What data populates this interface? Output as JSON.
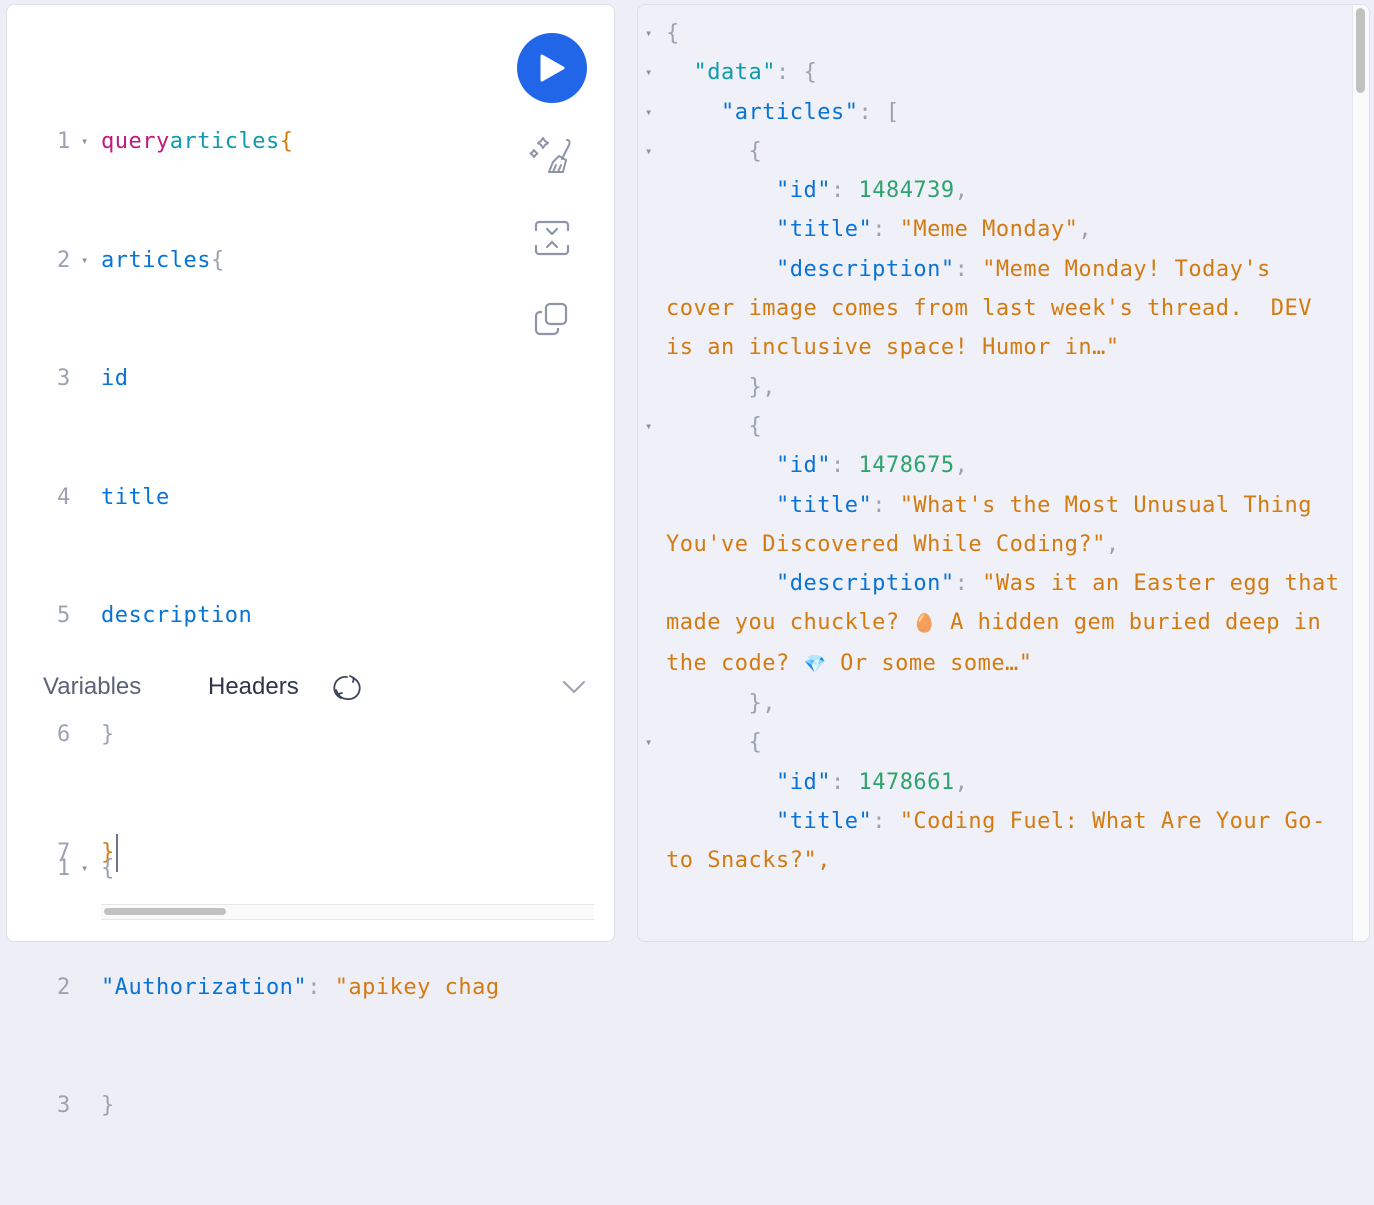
{
  "query_editor": {
    "lines": [
      {
        "num": "1",
        "fold": "▾",
        "keyword": "query",
        "name": "articles",
        "brace": "{"
      },
      {
        "num": "2",
        "fold": "▾",
        "field": "articles",
        "brace": "{"
      },
      {
        "num": "3",
        "field": "id"
      },
      {
        "num": "4",
        "field": "title"
      },
      {
        "num": "5",
        "field": "description"
      },
      {
        "num": "6",
        "brace": "}"
      },
      {
        "num": "7",
        "brace": "}"
      }
    ]
  },
  "toolbar": {
    "run_icon": "play-icon",
    "prettify_icon": "sparkle-broom-icon",
    "merge_icon": "merge-fragments-icon",
    "copy_icon": "copy-icon"
  },
  "bottom_tabs": {
    "variables_label": "Variables",
    "headers_label": "Headers",
    "refresh_icon": "refresh-icon",
    "collapse_icon": "chevron-down-icon"
  },
  "headers_editor": {
    "lines": [
      {
        "num": "1",
        "fold": "▾",
        "brace": "{"
      },
      {
        "num": "2",
        "key": "\"Authorization\"",
        "colon": ": ",
        "value": "\"apikey chag"
      },
      {
        "num": "3",
        "brace": "}"
      }
    ]
  },
  "result": {
    "root_open": "{",
    "data_key": "\"data\"",
    "articles_key": "\"articles\"",
    "articles": [
      {
        "id": "1484739",
        "title": "\"Meme Monday\"",
        "description": "\"Meme Monday! Today's cover image comes from last week's thread.  DEV is an inclusive space! Humor in…\""
      },
      {
        "id": "1478675",
        "title": "\"What's the Most Unusual Thing You've Discovered While Coding?\"",
        "description_a": "\"Was it an Easter egg that made you chuckle? ",
        "emoji_egg": "🥚",
        "description_b": " A hidden gem buried deep in the code? ",
        "emoji_gem": "💎",
        "description_c": " Or some some…\""
      },
      {
        "id": "1478661",
        "title": "\"Coding Fuel: What Are Your Go-to Snacks?\","
      }
    ],
    "keys": {
      "id": "\"id\"",
      "title": "\"title\"",
      "description": "\"description\""
    }
  }
}
